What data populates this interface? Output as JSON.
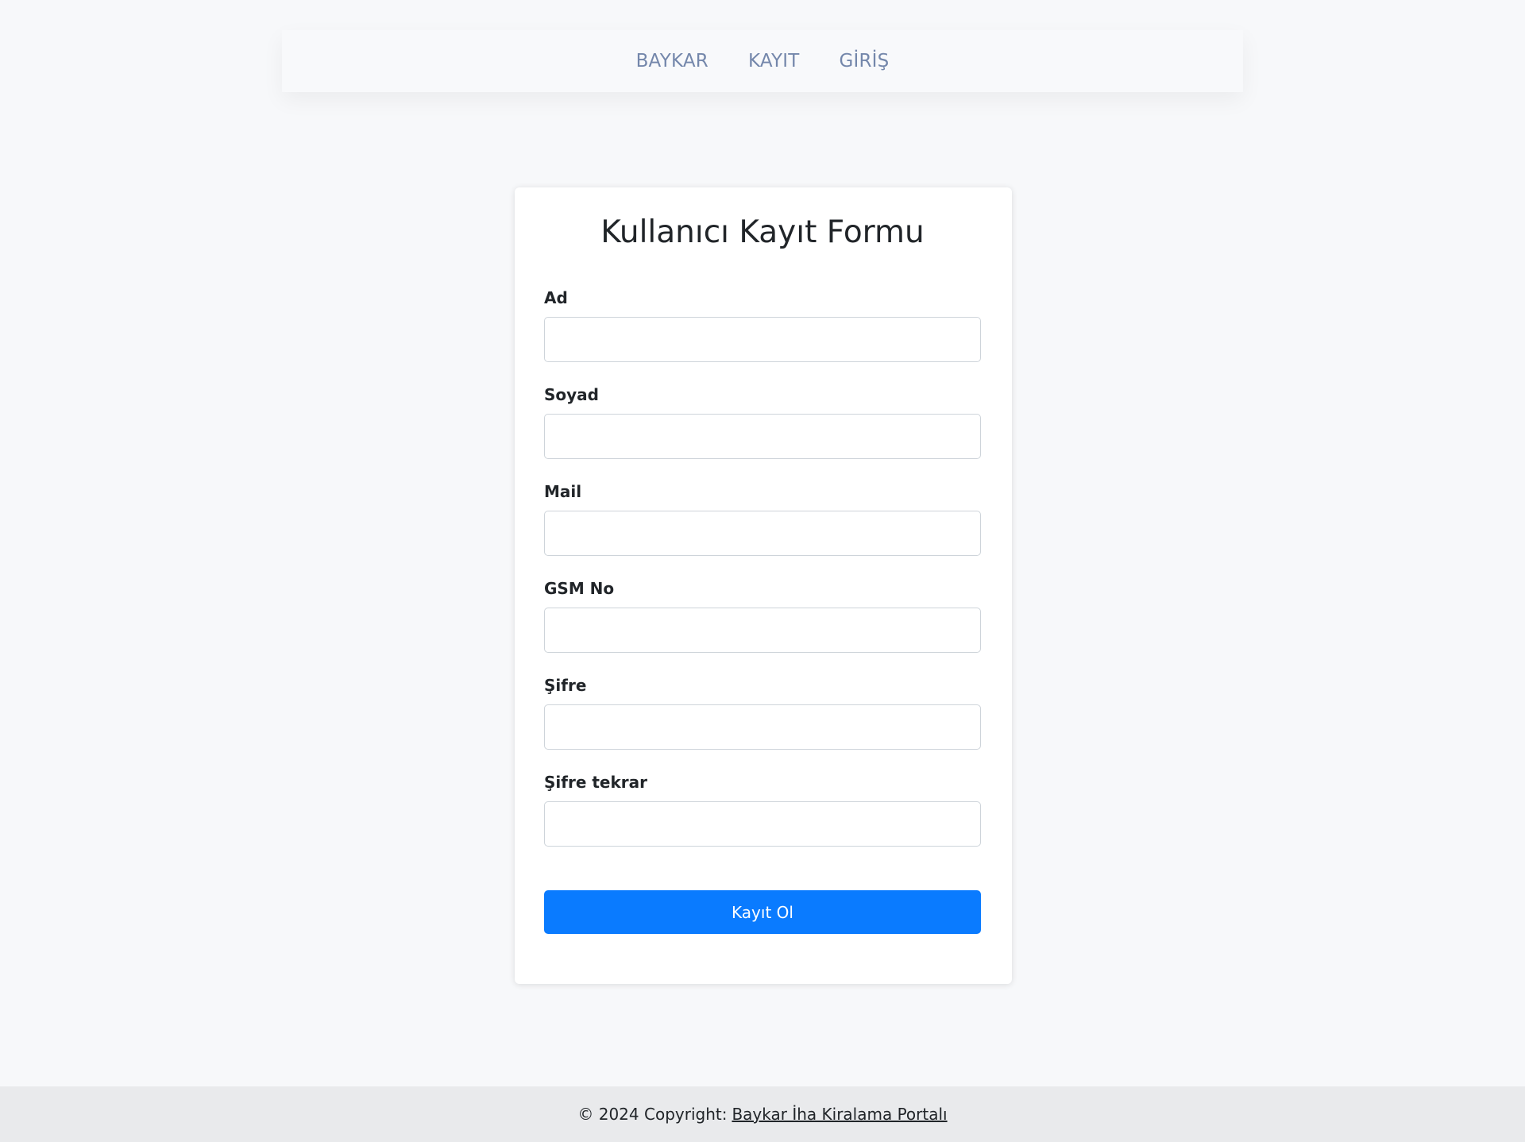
{
  "nav": {
    "items": [
      "BAYKAR",
      "KAYIT",
      "GİRİŞ"
    ]
  },
  "form": {
    "title": "Kullanıcı Kayıt Formu",
    "fields": [
      {
        "label": "Ad",
        "value": ""
      },
      {
        "label": "Soyad",
        "value": ""
      },
      {
        "label": "Mail",
        "value": ""
      },
      {
        "label": "GSM No",
        "value": ""
      },
      {
        "label": "Şifre",
        "value": ""
      },
      {
        "label": "Şifre tekrar",
        "value": ""
      }
    ],
    "submit_label": "Kayıt Ol"
  },
  "footer": {
    "copyright": "© 2024 Copyright:",
    "link_text": "Baykar İha Kiralama Portalı"
  },
  "colors": {
    "background": "#f7f8fa",
    "nav_link": "#7487ab",
    "primary_button": "#0a7bff",
    "footer_bg": "#e9eaec"
  }
}
